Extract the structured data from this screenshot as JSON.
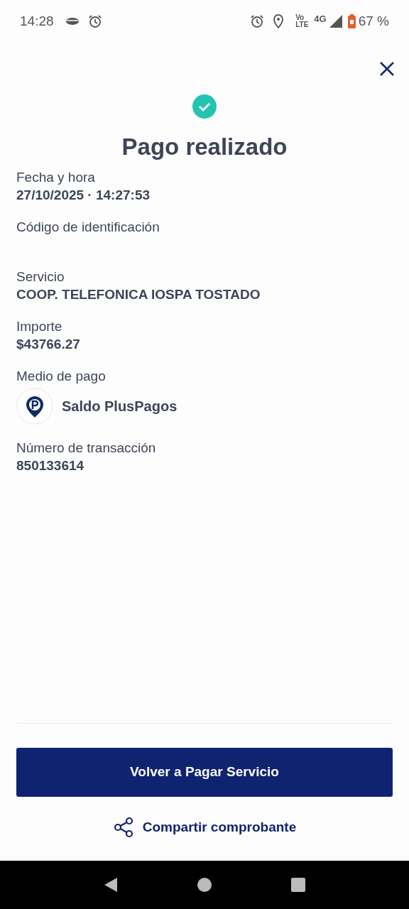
{
  "status_bar": {
    "time": "14:28",
    "volte_top": "Vo",
    "volte_bottom": "LTE",
    "network": "4G",
    "battery": "67 %"
  },
  "title": "Pago realizado",
  "fields": [
    {
      "kind": "text",
      "label": "Fecha y hora",
      "value": "27/10/2025 · 14:27:53"
    },
    {
      "kind": "empty",
      "label": "Código de identificación"
    },
    {
      "kind": "text",
      "label": "Servicio",
      "value": "COOP. TELEFONICA IOSPA TOSTADO"
    },
    {
      "kind": "text",
      "label": "Importe",
      "value": "$43766.27"
    },
    {
      "kind": "method",
      "label": "Medio de pago",
      "value": "Saldo PlusPagos"
    },
    {
      "kind": "text",
      "label": "Número de transacción",
      "value": "850133614"
    }
  ],
  "primary_button": "Volver a Pagar Servicio",
  "share_link": "Compartir comprobante"
}
